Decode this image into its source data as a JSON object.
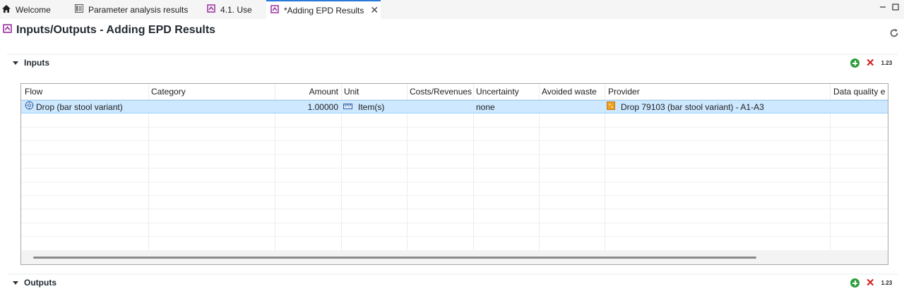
{
  "tabs": [
    {
      "label": "Welcome",
      "icon": "home-icon"
    },
    {
      "label": "Parameter analysis results",
      "icon": "table-icon"
    },
    {
      "label": "4.1. Use",
      "icon": "process-icon"
    },
    {
      "label": "*Adding EPD Results",
      "icon": "process-icon",
      "active": true
    }
  ],
  "editor": {
    "title": "Inputs/Outputs - Adding EPD Results"
  },
  "inputs": {
    "title": "Inputs",
    "format_label": "1.23",
    "columns": [
      "Flow",
      "Category",
      "Amount",
      "Unit",
      "Costs/Revenues",
      "Uncertainty",
      "Avoided waste",
      "Provider",
      "Data quality e"
    ],
    "rows": [
      {
        "flow": "Drop (bar stool variant)",
        "category": "",
        "amount": "1.00000",
        "unit": "Item(s)",
        "costs": "",
        "uncertainty": "none",
        "avoided_waste": "",
        "provider": "Drop 79103 (bar stool variant) - A1-A3",
        "data_quality": ""
      }
    ]
  },
  "outputs": {
    "title": "Outputs",
    "format_label": "1.23"
  },
  "colors": {
    "accent": "#2b79d8",
    "selection": "#cde8ff",
    "add": "#2f9e3c",
    "remove": "#d42020",
    "process_icon": "#9b2f9f",
    "provider_icon": "#f0a020"
  }
}
